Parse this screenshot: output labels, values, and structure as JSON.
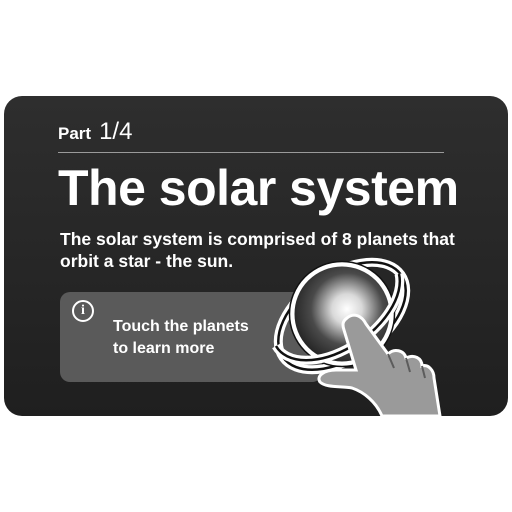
{
  "card": {
    "part_label": "Part",
    "part_number": "1/4",
    "title": "The solar system",
    "description": "The solar system is comprised of 8 planets that orbit a star - the sun.",
    "info": {
      "icon": "info-icon",
      "glyph": "i",
      "text_line1": "Touch the planets",
      "text_line2": "to learn more"
    },
    "illustration": {
      "planet": "planet-with-ring-icon",
      "hand": "pointing-hand-icon"
    }
  }
}
